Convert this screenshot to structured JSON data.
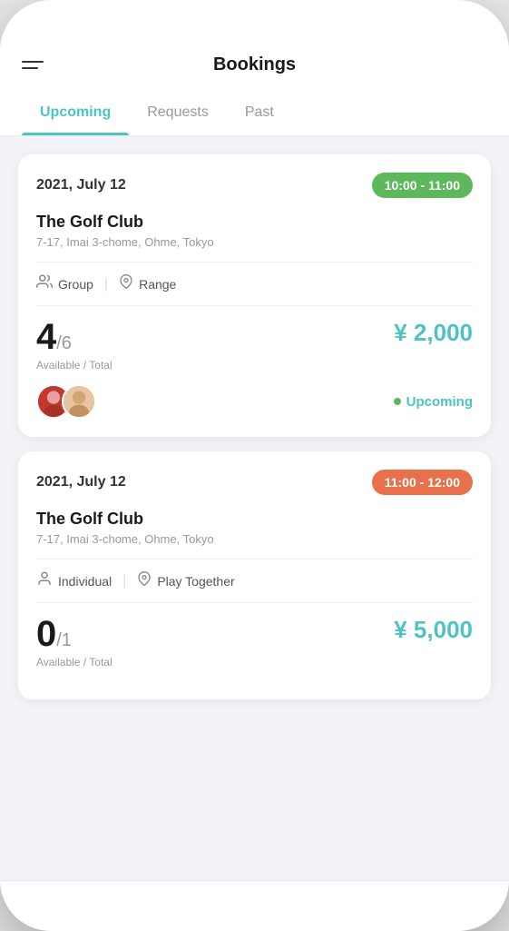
{
  "header": {
    "title": "Bookings",
    "menu_icon_label": "Menu"
  },
  "tabs": [
    {
      "id": "upcoming",
      "label": "Upcoming",
      "active": true
    },
    {
      "id": "requests",
      "label": "Requests",
      "active": false
    },
    {
      "id": "past",
      "label": "Past",
      "active": false
    }
  ],
  "bookings": [
    {
      "id": "booking-1",
      "date": "2021, July 12",
      "time": "10:00 - 11:00",
      "time_badge_color": "green",
      "venue_name": "The Golf Club",
      "venue_address": "7-17, Imai 3-chome, Ohme, Tokyo",
      "tags": [
        {
          "icon": "group-icon",
          "icon_symbol": "👥",
          "label": "Group"
        },
        {
          "icon": "location-icon",
          "icon_symbol": "📍",
          "label": "Range"
        }
      ],
      "available": "4",
      "total": "/6",
      "avail_label": "Available / Total",
      "price": "¥ 2,000",
      "status": "Upcoming",
      "has_avatars": true,
      "avatars": [
        {
          "id": "avatar-1",
          "color": "#c0392b"
        },
        {
          "id": "avatar-2",
          "color": "#e8a87c"
        }
      ]
    },
    {
      "id": "booking-2",
      "date": "2021, July 12",
      "time": "11:00 - 12:00",
      "time_badge_color": "orange",
      "venue_name": "The Golf Club",
      "venue_address": "7-17, Imai 3-chome, Ohme, Tokyo",
      "tags": [
        {
          "icon": "individual-icon",
          "icon_symbol": "🧍",
          "label": "Individual"
        },
        {
          "icon": "location-icon",
          "icon_symbol": "📍",
          "label": "Play Together"
        }
      ],
      "available": "0",
      "total": "/1",
      "avail_label": "Available / Total",
      "price": "¥ 5,000",
      "status": null,
      "has_avatars": false
    }
  ],
  "colors": {
    "accent": "#4FC3C3",
    "green_badge": "#5DB85C",
    "orange_badge": "#E8704A"
  }
}
